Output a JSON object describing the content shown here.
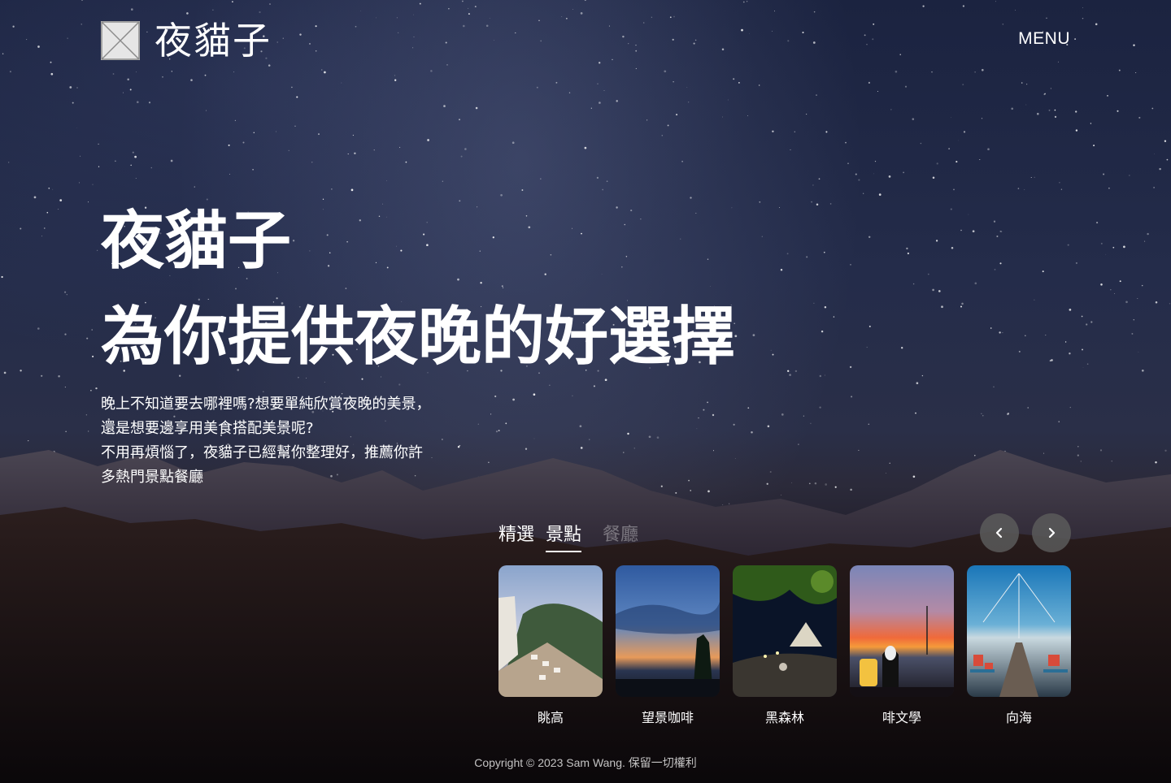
{
  "header": {
    "logo_text": "夜貓子",
    "menu_label": "MENU"
  },
  "hero": {
    "title_line1": "夜貓子",
    "title_line2": "為你提供夜晚的好選擇",
    "desc_lines": [
      "晚上不知道要去哪裡嗎?想要單純欣賞夜晚的美景，",
      "還是想要邊享用美食搭配美景呢?",
      "不用再煩惱了，夜貓子已經幫你整理好，推薦你許",
      "多熱門景點餐廳"
    ]
  },
  "tabs": [
    {
      "label": "精選",
      "state": "normal"
    },
    {
      "label": "景點",
      "state": "active"
    },
    {
      "label": "餐廳",
      "state": "muted"
    }
  ],
  "carousel": {
    "prev_icon": "chevron-left-icon",
    "next_icon": "chevron-right-icon",
    "cards": [
      {
        "label": "眺高"
      },
      {
        "label": "望景咖啡"
      },
      {
        "label": "黑森林"
      },
      {
        "label": "啡文學"
      },
      {
        "label": "向海"
      }
    ]
  },
  "footer": {
    "copyright": "Copyright © 2023 Sam Wang. 保留一切權利"
  },
  "colors": {
    "text": "#ffffff",
    "nav_button_bg": "#5a5a5a",
    "logo_mark": "#e9e9e9"
  }
}
